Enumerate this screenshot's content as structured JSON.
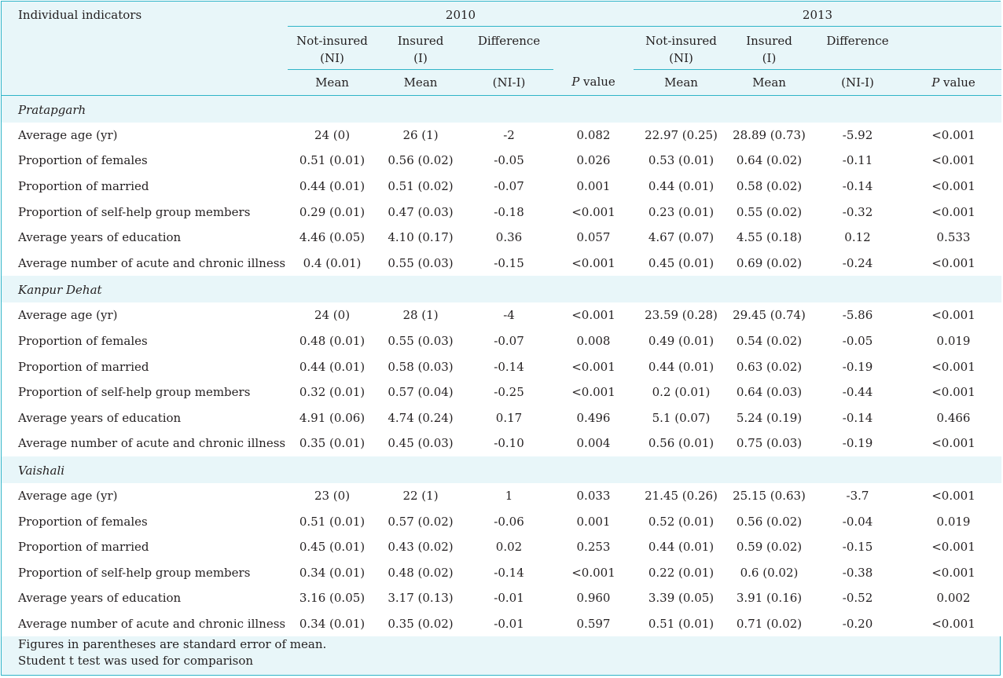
{
  "header": {
    "indicator_label": "Individual indicators",
    "year_a": "2010",
    "year_b": "2013",
    "not_insured": "Not-insured",
    "not_insured_abbr": "(NI)",
    "insured": "Insured",
    "insured_abbr": "(I)",
    "difference": "Difference",
    "mean": "Mean",
    "diff_formula": "(NI-I)",
    "p_italic": "P",
    "p_value_suffix": " value"
  },
  "sections": [
    {
      "name": "Pratapgarh",
      "rows": [
        {
          "label": "Average age (yr)",
          "v": [
            "24 (0)",
            "26 (1)",
            "-2",
            "0.082",
            "22.97 (0.25)",
            "28.89 (0.73)",
            "-5.92",
            "<0.001"
          ]
        },
        {
          "label": "Proportion of females",
          "v": [
            "0.51 (0.01)",
            "0.56 (0.02)",
            "-0.05",
            "0.026",
            "0.53 (0.01)",
            "0.64 (0.02)",
            "-0.11",
            "<0.001"
          ]
        },
        {
          "label": "Proportion of married",
          "v": [
            "0.44 (0.01)",
            "0.51 (0.02)",
            "-0.07",
            "0.001",
            "0.44 (0.01)",
            "0.58 (0.02)",
            "-0.14",
            "<0.001"
          ]
        },
        {
          "label": "Proportion of self-help group members",
          "v": [
            "0.29 (0.01)",
            "0.47 (0.03)",
            "-0.18",
            "<0.001",
            "0.23 (0.01)",
            "0.55 (0.02)",
            "-0.32",
            "<0.001"
          ]
        },
        {
          "label": "Average years of education",
          "v": [
            "4.46 (0.05)",
            "4.10 (0.17)",
            "0.36",
            "0.057",
            "4.67 (0.07)",
            "4.55 (0.18)",
            "0.12",
            "0.533"
          ]
        },
        {
          "label": "Average number of acute and chronic illness",
          "v": [
            "0.4 (0.01)",
            "0.55 (0.03)",
            "-0.15",
            "<0.001",
            "0.45 (0.01)",
            "0.69 (0.02)",
            "-0.24",
            "<0.001"
          ]
        }
      ]
    },
    {
      "name": "Kanpur Dehat",
      "rows": [
        {
          "label": "Average age (yr)",
          "v": [
            "24 (0)",
            "28 (1)",
            "-4",
            "<0.001",
            "23.59 (0.28)",
            "29.45 (0.74)",
            "-5.86",
            "<0.001"
          ]
        },
        {
          "label": "Proportion of females",
          "v": [
            "0.48 (0.01)",
            "0.55 (0.03)",
            "-0.07",
            "0.008",
            "0.49 (0.01)",
            "0.54 (0.02)",
            "-0.05",
            "0.019"
          ]
        },
        {
          "label": "Proportion of married",
          "v": [
            "0.44 (0.01)",
            "0.58 (0.03)",
            "-0.14",
            "<0.001",
            "0.44 (0.01)",
            "0.63 (0.02)",
            "-0.19",
            "<0.001"
          ]
        },
        {
          "label": "Proportion of self-help group members",
          "v": [
            "0.32 (0.01)",
            "0.57 (0.04)",
            "-0.25",
            "<0.001",
            "0.2 (0.01)",
            "0.64 (0.03)",
            "-0.44",
            "<0.001"
          ]
        },
        {
          "label": "Average years of education",
          "v": [
            "4.91 (0.06)",
            "4.74 (0.24)",
            "0.17",
            "0.496",
            "5.1 (0.07)",
            "5.24 (0.19)",
            "-0.14",
            "0.466"
          ]
        },
        {
          "label": "Average number of acute and chronic illness",
          "v": [
            "0.35 (0.01)",
            "0.45 (0.03)",
            "-0.10",
            "0.004",
            "0.56 (0.01)",
            "0.75 (0.03)",
            "-0.19",
            "<0.001"
          ]
        }
      ]
    },
    {
      "name": "Vaishali",
      "rows": [
        {
          "label": "Average age (yr)",
          "v": [
            "23 (0)",
            "22 (1)",
            "1",
            "0.033",
            "21.45 (0.26)",
            "25.15 (0.63)",
            "-3.7",
            "<0.001"
          ]
        },
        {
          "label": "Proportion of females",
          "v": [
            "0.51 (0.01)",
            "0.57 (0.02)",
            "-0.06",
            "0.001",
            "0.52 (0.01)",
            "0.56 (0.02)",
            "-0.04",
            "0.019"
          ]
        },
        {
          "label": "Proportion of married",
          "v": [
            "0.45 (0.01)",
            "0.43 (0.02)",
            "0.02",
            "0.253",
            "0.44 (0.01)",
            "0.59 (0.02)",
            "-0.15",
            "<0.001"
          ]
        },
        {
          "label": "Proportion of self-help group members",
          "v": [
            "0.34 (0.01)",
            "0.48 (0.02)",
            "-0.14",
            "<0.001",
            "0.22 (0.01)",
            "0.6 (0.02)",
            "-0.38",
            "<0.001"
          ]
        },
        {
          "label": "Average years of education",
          "v": [
            "3.16 (0.05)",
            "3.17 (0.13)",
            "-0.01",
            "0.960",
            "3.39 (0.05)",
            "3.91 (0.16)",
            "-0.52",
            "0.002"
          ]
        },
        {
          "label": "Average number of acute and chronic illness",
          "v": [
            "0.34 (0.01)",
            "0.35 (0.02)",
            "-0.01",
            "0.597",
            "0.51 (0.01)",
            "0.71 (0.02)",
            "-0.20",
            "<0.001"
          ]
        }
      ]
    }
  ],
  "footnotes": [
    "Figures in parentheses are standard  error of mean.",
    "Student t test was used for comparison"
  ],
  "colors": {
    "border": "#2fb4c8",
    "background": "#e8f6f9",
    "row_background": "#ffffff"
  }
}
